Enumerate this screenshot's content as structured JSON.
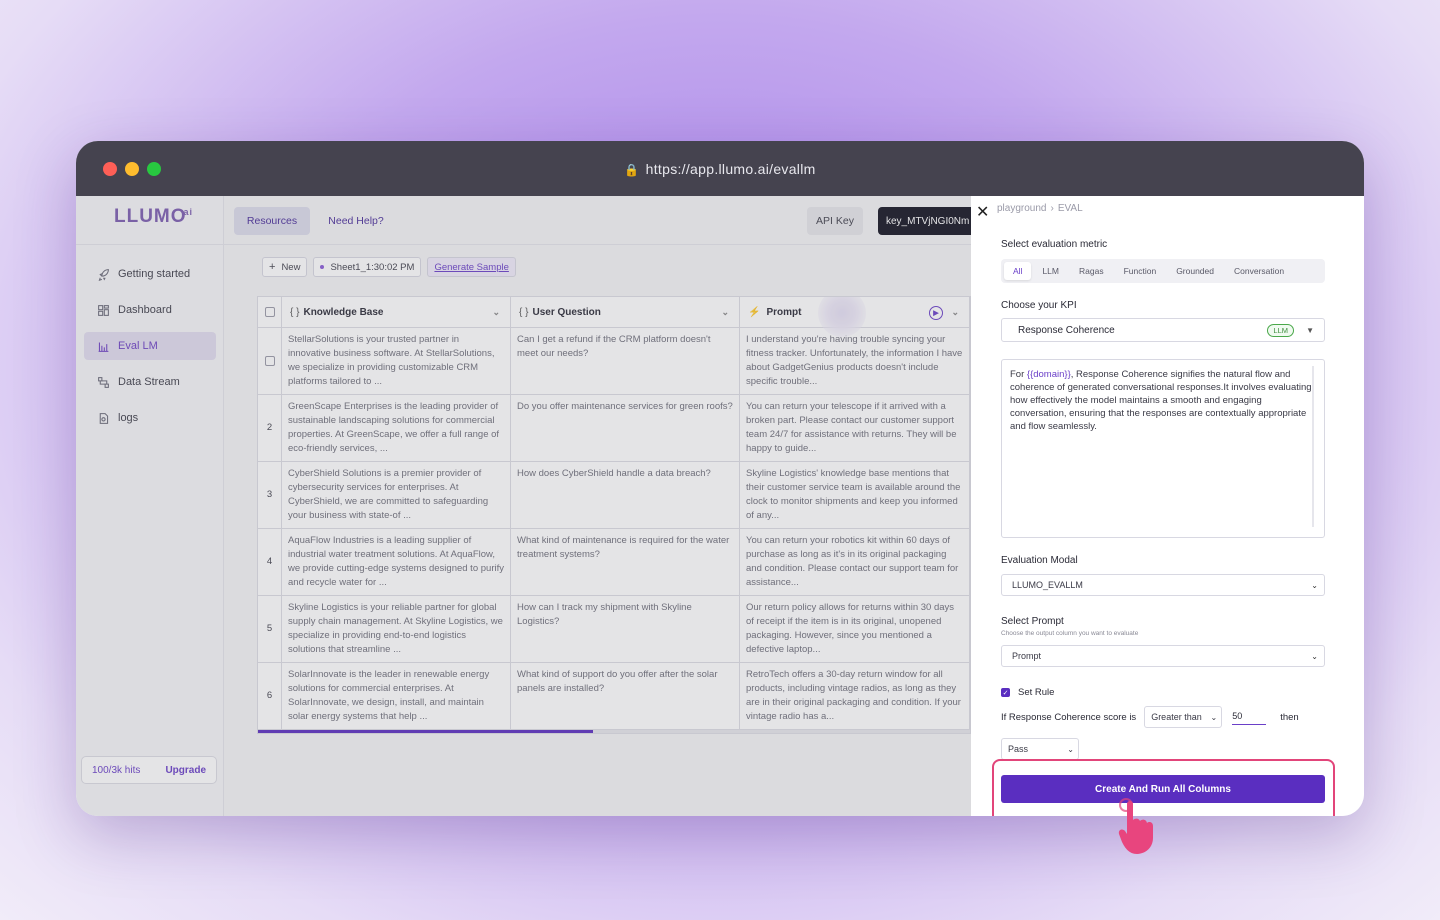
{
  "browser": {
    "url": "https://app.llumo.ai/evallm"
  },
  "brand": {
    "name": "LLUMO",
    "suffix": "ai"
  },
  "sidebar": {
    "items": [
      {
        "label": "Getting started",
        "icon": "rocket-icon"
      },
      {
        "label": "Dashboard",
        "icon": "dashboard-icon"
      },
      {
        "label": "Eval LM",
        "icon": "chart-icon",
        "active": true
      },
      {
        "label": "Data Stream",
        "icon": "data-stream-icon"
      },
      {
        "label": "logs",
        "icon": "logs-icon"
      }
    ],
    "hits": "100/3k hits",
    "upgrade": "Upgrade"
  },
  "topbar": {
    "resources": "Resources",
    "help": "Need Help?",
    "api_key_label": "API Key",
    "api_key_value": "key_MTVjNGI0Nm"
  },
  "toolbar": {
    "new": "New",
    "sheet": "Sheet1_1:30:02 PM",
    "generate": "Generate Sample"
  },
  "table": {
    "columns": [
      "Knowledge Base",
      "User Question",
      "Prompt"
    ],
    "rows": [
      {
        "num": "",
        "kb": "StellarSolutions is your trusted partner in innovative business software. At StellarSolutions, we specialize in providing customizable CRM platforms tailored to ...",
        "q": "Can I get a refund if the CRM platform doesn't meet our needs?",
        "p": "I understand you're having trouble syncing your fitness tracker. Unfortunately, the information I have about GadgetGenius products doesn't include specific trouble..."
      },
      {
        "num": "2",
        "kb": "GreenScape Enterprises is the leading provider of sustainable landscaping solutions for commercial properties. At GreenScape, we offer a full range of eco-friendly services, ...",
        "q": "Do you offer maintenance services for green roofs?",
        "p": "You can return your telescope if it arrived with a broken part. Please contact our customer support team 24/7 for assistance with returns. They will be happy to guide..."
      },
      {
        "num": "3",
        "kb": "CyberShield Solutions is a premier provider of cybersecurity services for enterprises. At CyberShield, we are committed to safeguarding your business with state-of ...",
        "q": "How does CyberShield handle a data breach?",
        "p": "Skyline Logistics' knowledge base mentions that their customer service team is available around the clock to monitor shipments and keep you informed of any..."
      },
      {
        "num": "4",
        "kb": "AquaFlow Industries is a leading supplier of industrial water treatment solutions. At AquaFlow, we provide cutting-edge systems designed to purify and recycle water for ...",
        "q": "What kind of maintenance is required for the water treatment systems?",
        "p": "You can return your robotics kit within 60 days of purchase as long as it's in its original packaging and condition. Please contact our support team for assistance..."
      },
      {
        "num": "5",
        "kb": "Skyline Logistics is your reliable partner for global supply chain management. At Skyline Logistics, we specialize in providing end-to-end logistics solutions that streamline ...",
        "q": "How can I track my shipment with Skyline Logistics?",
        "p": "Our return policy allows for returns within 30 days of receipt if the item is in its original, unopened packaging. However, since you mentioned a defective laptop..."
      },
      {
        "num": "6",
        "kb": "SolarInnovate is the leader in renewable energy solutions for commercial enterprises. At SolarInnovate, we design, install, and maintain solar energy systems that help ...",
        "q": "What kind of support do you offer after the solar panels are installed?",
        "p": "RetroTech offers a 30-day return window for all products, including vintage radios, as long as they are in their original packaging and condition. If your vintage radio has a..."
      }
    ]
  },
  "panel": {
    "crumb_root": "playground",
    "crumb_current": "EVAL",
    "metric_label": "Select evaluation metric",
    "tabs": [
      "All",
      "LLM",
      "Ragas",
      "Function",
      "Grounded",
      "Conversation"
    ],
    "kpi_label": "Choose your KPI",
    "kpi_value": "Response Coherence",
    "kpi_badge": "LLM",
    "desc_prefix": "For ",
    "desc_var": "{{domain}}",
    "desc_rest": ", Response Coherence signifies the natural flow and coherence of generated conversational responses.It involves evaluating how effectively the model maintains a smooth and engaging conversation, ensuring that the responses are contextually appropriate and flow seamlessly.",
    "model_label": "Evaluation Modal",
    "model_value": "LLUMO_EVALLM",
    "prompt_label": "Select Prompt",
    "prompt_sub": "Choose the output column you want to evaluate",
    "prompt_value": "Prompt",
    "set_rule": "Set Rule",
    "rule_prefix": "If Response Coherence score is",
    "rule_op": "Greater than",
    "rule_threshold": "50",
    "rule_then": "then",
    "rule_result": "Pass",
    "create_button": "Create And Run All Columns"
  }
}
